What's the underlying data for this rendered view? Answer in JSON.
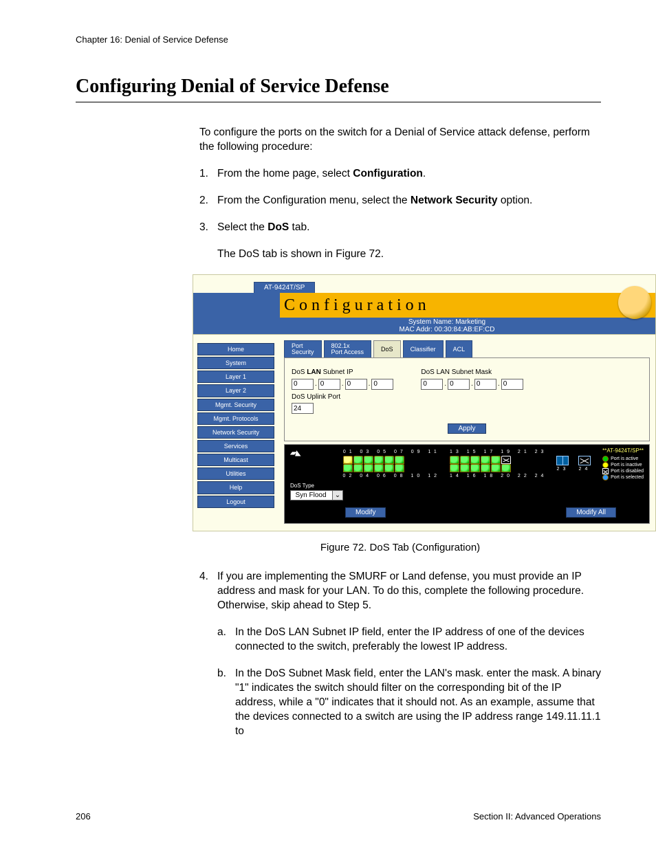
{
  "doc": {
    "chapter_line": "Chapter 16: Denial of Service Defense",
    "title": "Configuring Denial of Service Defense",
    "intro": "To configure the ports on the switch for a Denial of Service attack defense, perform the following procedure:",
    "step1_a": "From the home page, select ",
    "step1_b": "Configuration",
    "step1_c": ".",
    "step2_a": "From the Configuration menu, select the ",
    "step2_b": "Network Security",
    "step2_c": " option.",
    "step3_a": "Select the ",
    "step3_b": "DoS",
    "step3_c": " tab.",
    "after3": "The DoS tab is shown in Figure 72.",
    "fig_caption": "Figure 72. DoS Tab (Configuration)",
    "step4": "If you are implementing the SMURF or Land defense, you must provide an IP address and mask for your LAN. To do this, complete the following procedure. Otherwise, skip ahead to Step 5.",
    "step4a": "In the DoS LAN Subnet IP field, enter the IP address of one of the devices connected to the switch, preferably the lowest IP address.",
    "step4b": "In the DoS Subnet Mask field, enter the LAN's mask. enter the mask. A binary \"1\" indicates the switch should filter on the corresponding bit of the IP address, while a \"0\" indicates that it should not. As an example, assume that the devices connected to a switch are using the IP address range 149.11.11.1 to",
    "page_number": "206",
    "footer_right": "Section II: Advanced Operations"
  },
  "ui": {
    "model_tab": "AT-9424T/SP",
    "banner_title": "Configuration",
    "sys_name": "System Name: Marketing",
    "mac": "MAC Addr: 00:30:84:AB:EF:CD",
    "sidebar": [
      "Home",
      "System",
      "Layer 1",
      "Layer 2",
      "Mgmt. Security",
      "Mgmt. Protocols",
      "Network Security",
      "Services",
      "Multicast",
      "Utilities",
      "Help",
      "Logout"
    ],
    "tabs": {
      "port_security_l1": "Port",
      "port_security_l2": "Security",
      "port_access_l1": "802.1x",
      "port_access_l2": "Port Access",
      "dos": "DoS",
      "classifier": "Classifier",
      "acl": "ACL"
    },
    "labels": {
      "lan_ip_a": "DoS ",
      "lan_ip_b": "LAN",
      "lan_ip_c": " Subnet IP",
      "lan_mask": "DoS LAN Subnet Mask",
      "uplink": "DoS Uplink Port",
      "dos_type": "DoS Type"
    },
    "values": {
      "ip": [
        "0",
        "0",
        "0",
        "0"
      ],
      "mask": [
        "0",
        "0",
        "0",
        "0"
      ],
      "uplink": "24",
      "dos_type": "Syn Flood"
    },
    "buttons": {
      "apply": "Apply",
      "modify": "Modify",
      "modify_all": "Modify All"
    },
    "ports": {
      "top_nums": "01 03 05 07 09 11",
      "top_nums2": "13 15 17 19 21 23",
      "bot_nums": "02 04 06 08 10 12",
      "bot_nums2": "14 16 18 20 22 24",
      "u1": "23",
      "u2": "24",
      "model": "**AT-9424T/SP**"
    },
    "legend": {
      "active": "Port is active",
      "inactive": "Port is inactive",
      "disabled": "Port is disabled",
      "selected": "Port is selected"
    }
  }
}
